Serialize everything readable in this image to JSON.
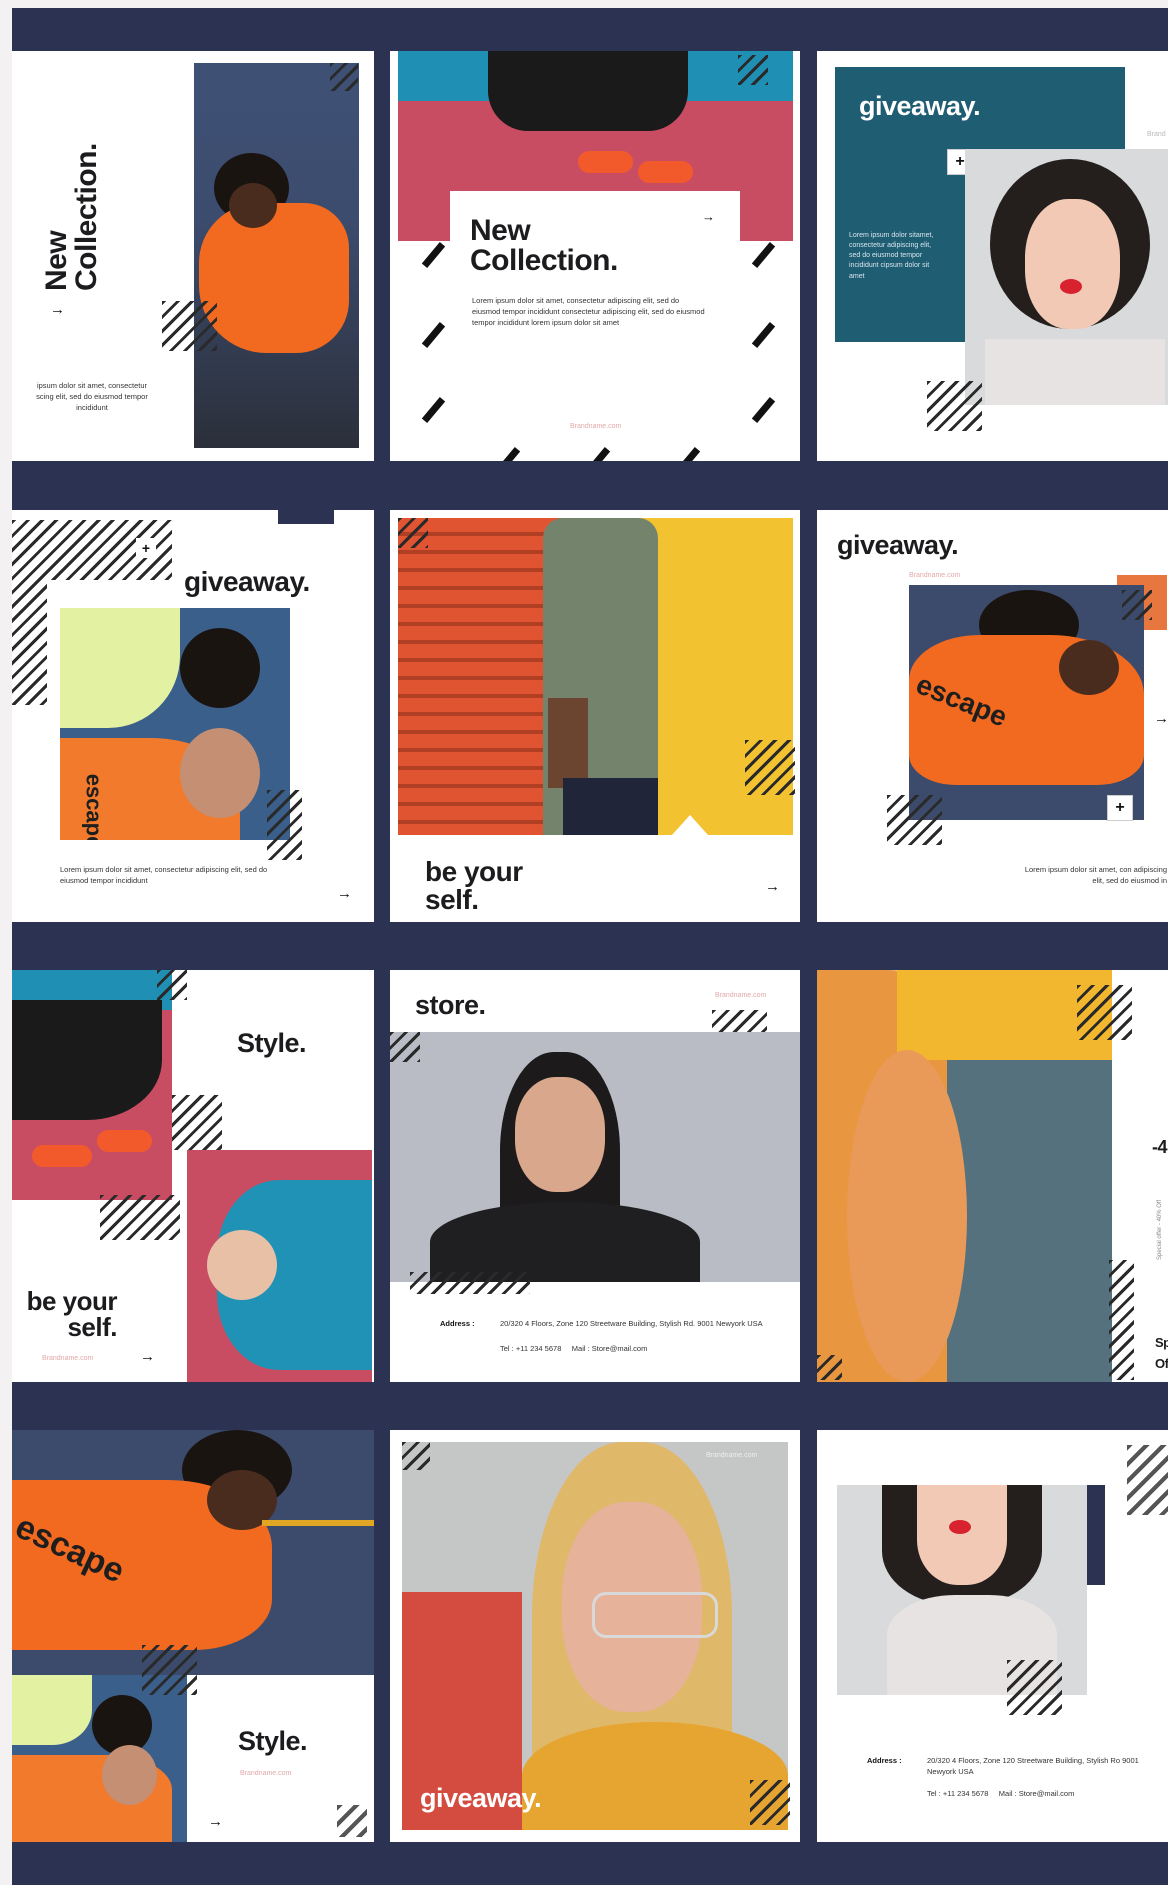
{
  "posts": {
    "p1": {
      "title_line1": "New",
      "title_line2": "Collection.",
      "body": "ipsum dolor sit amet, consectetur\nscing elit, sed do eiusmod tempor\nincididunt"
    },
    "p2": {
      "title_line1": "New",
      "title_line2": "Collection.",
      "body": "Lorem ipsum dolor sit amet, consectetur adipiscing elit, sed do eiusmod tempor incididunt consectetur adipiscing elit, sed do eiusmod tempor incididunt lorem ipsum dolor sit amet",
      "brand": "Brandname.com"
    },
    "p3": {
      "title": "giveaway.",
      "body": "Lorem ipsum dolor sitamet, consectetur adipiscing elit, sed do eiusmod tempor incididunt cipsum dolor sit amet",
      "brand": "Brand"
    },
    "p4": {
      "title": "giveaway.",
      "body": "Lorem ipsum dolor sit amet, consectetur adipiscing elit, sed do eiusmod tempor incididunt",
      "shirt_text": "escape"
    },
    "p5": {
      "title_line1": "be your",
      "title_line2": "self."
    },
    "p6": {
      "title": "giveaway.",
      "brand": "Brandname.com",
      "body": "Lorem ipsum dolor sit amet, con adipiscing elit, sed do eiusmod in",
      "shirt_text": "escape"
    },
    "p7": {
      "title": "Style.",
      "tag_line1": "be your",
      "tag_line2": "self.",
      "brand": "Brandname.com"
    },
    "p8": {
      "title": "store.",
      "brand": "Brandname.com",
      "address_label": "Address :",
      "address": "20/320 4 Floors, Zone 120 Streetware Building, Stylish Rd. 9001 Newyork USA",
      "contact": "Tel : +11 234 5678     Mail : Store@mail.com"
    },
    "p9": {
      "sale": "-4",
      "side_text": "Special offer - 40% Off",
      "offer_line1": "Sp",
      "offer_line2": "Of"
    },
    "p10": {
      "title": "Style.",
      "brand": "Brandname.com",
      "shirt_text": "escape"
    },
    "p11": {
      "title": "giveaway.",
      "brand": "Brandname.com"
    },
    "p12": {
      "address_label": "Address :",
      "address": "20/320 4 Floors, Zone 120 Streetware Building, Stylish Ro 9001 Newyork USA",
      "contact": "Tel : +11 234 5678     Mail : Store@mail.com"
    }
  },
  "icons": {
    "arrow": "→",
    "plus": "+"
  },
  "colors": {
    "navy": "#2c3352",
    "teal": "#1f5d73",
    "orange": "#f06a27",
    "pink": "#c8506a",
    "yellow": "#f1c232",
    "blue": "#2196b8"
  }
}
